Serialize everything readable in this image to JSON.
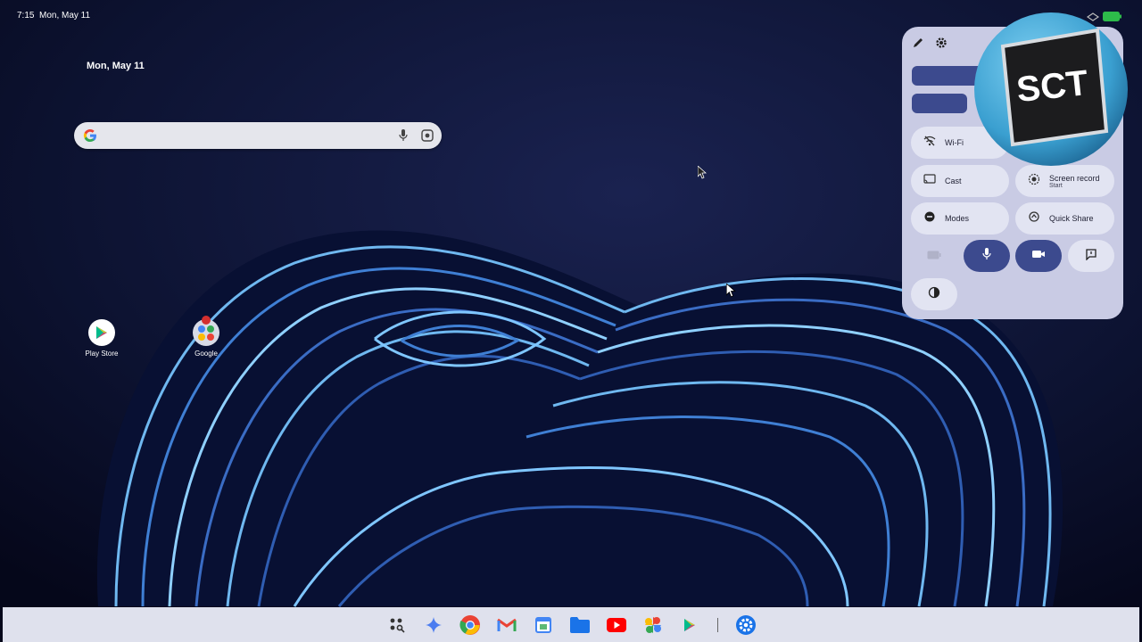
{
  "status_bar": {
    "time": "7:15",
    "date": "Mon, May 11"
  },
  "date_widget": "Mon, May 11",
  "search": {
    "placeholder": "",
    "logo_letter": "G"
  },
  "desktop_apps": [
    {
      "label": "Play Store",
      "icon": "play-store-icon"
    },
    {
      "label": "Google",
      "icon": "google-folder-icon"
    }
  ],
  "quick_settings": {
    "tiles": [
      {
        "label": "Wi-Fi",
        "icon": "wifi-off-icon"
      },
      {
        "label": "Cast",
        "icon": "cast-icon"
      },
      {
        "label": "Screen record",
        "sub": "Start",
        "icon": "screen-record-icon"
      },
      {
        "label": "Modes",
        "icon": "modes-icon"
      },
      {
        "label": "Quick Share",
        "icon": "quick-share-icon"
      }
    ],
    "small_tiles": [
      "battery-saver-icon",
      "mic-icon",
      "camera-icon",
      "feedback-icon",
      "contrast-icon"
    ]
  },
  "logo_text": "SCT",
  "dock_apps": [
    "app-launcher-icon",
    "gemini-icon",
    "chrome-icon",
    "gmail-icon",
    "calendar-icon",
    "files-icon",
    "youtube-icon",
    "photos-icon",
    "play-store-icon",
    "settings-icon"
  ],
  "colors": {
    "panel": "#c9cbe4",
    "accent": "#3c4a8e",
    "taskbar": "#dfe1ed"
  }
}
